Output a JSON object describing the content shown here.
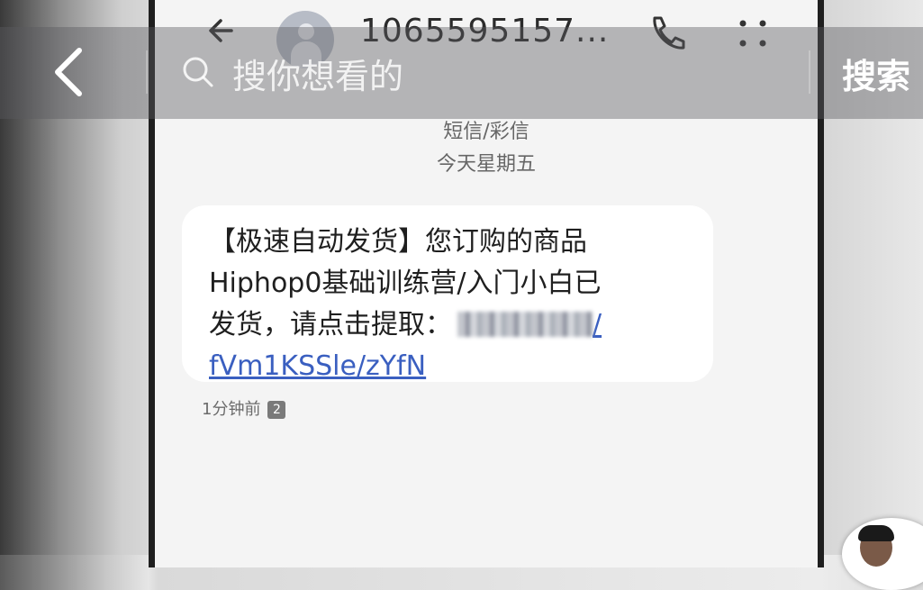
{
  "overlay": {
    "search_placeholder": "搜你想看的",
    "search_button": "搜索"
  },
  "phone": {
    "sender_number": "1065595157...",
    "message_type": "短信/彩信",
    "date_label": "今天星期五",
    "message": {
      "line1": "【极速自动发货】您订购的商品",
      "line2": "Hiphop0基础训练营/入门小白已",
      "line3_text": "发货，请点击提取：",
      "line3_link_tail": "/",
      "line4_link": "fVm1KSSle/zYfN"
    },
    "time_ago": "1分钟前",
    "sim_slot": "2"
  },
  "icons": {
    "overlay_back": "chevron-left-icon",
    "search": "search-icon",
    "phone_back": "arrow-left-icon",
    "call": "phone-icon",
    "more": "more-dots-icon",
    "avatar": "contact-avatar-icon"
  },
  "colors": {
    "link": "#3a5fc0",
    "overlay": "#5a5a5f",
    "bubble": "#ffffff"
  }
}
